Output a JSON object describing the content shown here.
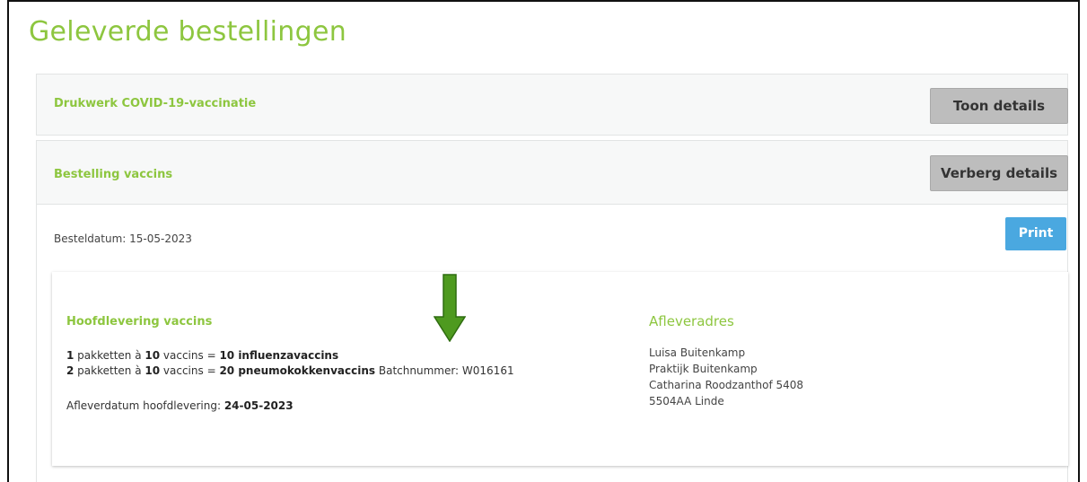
{
  "page": {
    "title": "Geleverde bestellingen"
  },
  "orders": [
    {
      "title": "Drukwerk COVID-19-vaccinatie",
      "toggle_label": "Toon details"
    },
    {
      "title": "Bestelling vaccins",
      "toggle_label": "Verberg details"
    }
  ],
  "details": {
    "order_date_label": "Besteldatum:",
    "order_date": "15-05-2023",
    "print_label": "Print",
    "delivery": {
      "title": "Hoofdlevering vaccins",
      "line1": {
        "count": "1",
        "text_a": " pakketten à ",
        "per": "10",
        "text_b": " vaccins = ",
        "total": "10 influenzavaccins"
      },
      "line2": {
        "count": "2",
        "text_a": " pakketten à ",
        "per": "10",
        "text_b": " vaccins = ",
        "total": "20 pneumokokkenvaccins",
        "batch": " Batchnummer: W016161"
      },
      "delivery_date_label": "Afleverdatum hoofdlevering: ",
      "delivery_date": "24-05-2023"
    },
    "address": {
      "title": "Afleveradres",
      "lines": [
        "Luisa Buitenkamp",
        "Praktijk Buitenkamp",
        "Catharina Roodzanthof 5408",
        "5504AA Linde"
      ]
    }
  },
  "colors": {
    "accent": "#8dc63f",
    "print": "#4aa8e0",
    "button_grey": "#bdbdbd",
    "arrow": "#4e9a1f"
  },
  "icons": {
    "annotation_arrow": "arrow-down-icon"
  }
}
